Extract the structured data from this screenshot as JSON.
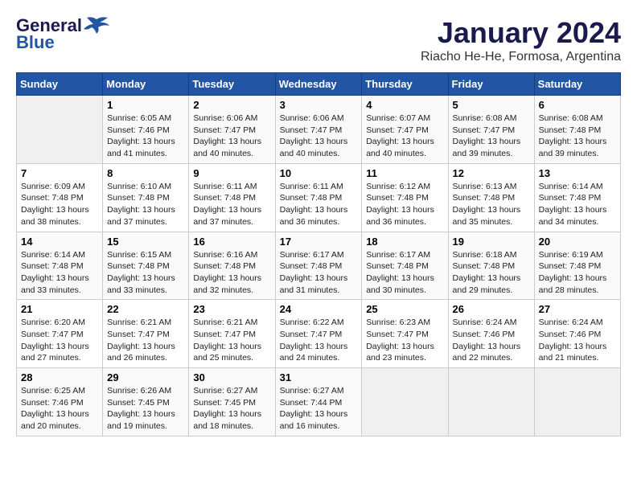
{
  "header": {
    "logo_line1": "General",
    "logo_line2": "Blue",
    "month": "January 2024",
    "location": "Riacho He-He, Formosa, Argentina"
  },
  "weekdays": [
    "Sunday",
    "Monday",
    "Tuesday",
    "Wednesday",
    "Thursday",
    "Friday",
    "Saturday"
  ],
  "weeks": [
    [
      null,
      {
        "day": 1,
        "sunrise": "6:05 AM",
        "sunset": "7:46 PM",
        "daylight": "13 hours and 41 minutes."
      },
      {
        "day": 2,
        "sunrise": "6:06 AM",
        "sunset": "7:47 PM",
        "daylight": "13 hours and 40 minutes."
      },
      {
        "day": 3,
        "sunrise": "6:06 AM",
        "sunset": "7:47 PM",
        "daylight": "13 hours and 40 minutes."
      },
      {
        "day": 4,
        "sunrise": "6:07 AM",
        "sunset": "7:47 PM",
        "daylight": "13 hours and 40 minutes."
      },
      {
        "day": 5,
        "sunrise": "6:08 AM",
        "sunset": "7:47 PM",
        "daylight": "13 hours and 39 minutes."
      },
      {
        "day": 6,
        "sunrise": "6:08 AM",
        "sunset": "7:48 PM",
        "daylight": "13 hours and 39 minutes."
      }
    ],
    [
      {
        "day": 7,
        "sunrise": "6:09 AM",
        "sunset": "7:48 PM",
        "daylight": "13 hours and 38 minutes."
      },
      {
        "day": 8,
        "sunrise": "6:10 AM",
        "sunset": "7:48 PM",
        "daylight": "13 hours and 37 minutes."
      },
      {
        "day": 9,
        "sunrise": "6:11 AM",
        "sunset": "7:48 PM",
        "daylight": "13 hours and 37 minutes."
      },
      {
        "day": 10,
        "sunrise": "6:11 AM",
        "sunset": "7:48 PM",
        "daylight": "13 hours and 36 minutes."
      },
      {
        "day": 11,
        "sunrise": "6:12 AM",
        "sunset": "7:48 PM",
        "daylight": "13 hours and 36 minutes."
      },
      {
        "day": 12,
        "sunrise": "6:13 AM",
        "sunset": "7:48 PM",
        "daylight": "13 hours and 35 minutes."
      },
      {
        "day": 13,
        "sunrise": "6:14 AM",
        "sunset": "7:48 PM",
        "daylight": "13 hours and 34 minutes."
      }
    ],
    [
      {
        "day": 14,
        "sunrise": "6:14 AM",
        "sunset": "7:48 PM",
        "daylight": "13 hours and 33 minutes."
      },
      {
        "day": 15,
        "sunrise": "6:15 AM",
        "sunset": "7:48 PM",
        "daylight": "13 hours and 33 minutes."
      },
      {
        "day": 16,
        "sunrise": "6:16 AM",
        "sunset": "7:48 PM",
        "daylight": "13 hours and 32 minutes."
      },
      {
        "day": 17,
        "sunrise": "6:17 AM",
        "sunset": "7:48 PM",
        "daylight": "13 hours and 31 minutes."
      },
      {
        "day": 18,
        "sunrise": "6:17 AM",
        "sunset": "7:48 PM",
        "daylight": "13 hours and 30 minutes."
      },
      {
        "day": 19,
        "sunrise": "6:18 AM",
        "sunset": "7:48 PM",
        "daylight": "13 hours and 29 minutes."
      },
      {
        "day": 20,
        "sunrise": "6:19 AM",
        "sunset": "7:48 PM",
        "daylight": "13 hours and 28 minutes."
      }
    ],
    [
      {
        "day": 21,
        "sunrise": "6:20 AM",
        "sunset": "7:47 PM",
        "daylight": "13 hours and 27 minutes."
      },
      {
        "day": 22,
        "sunrise": "6:21 AM",
        "sunset": "7:47 PM",
        "daylight": "13 hours and 26 minutes."
      },
      {
        "day": 23,
        "sunrise": "6:21 AM",
        "sunset": "7:47 PM",
        "daylight": "13 hours and 25 minutes."
      },
      {
        "day": 24,
        "sunrise": "6:22 AM",
        "sunset": "7:47 PM",
        "daylight": "13 hours and 24 minutes."
      },
      {
        "day": 25,
        "sunrise": "6:23 AM",
        "sunset": "7:47 PM",
        "daylight": "13 hours and 23 minutes."
      },
      {
        "day": 26,
        "sunrise": "6:24 AM",
        "sunset": "7:46 PM",
        "daylight": "13 hours and 22 minutes."
      },
      {
        "day": 27,
        "sunrise": "6:24 AM",
        "sunset": "7:46 PM",
        "daylight": "13 hours and 21 minutes."
      }
    ],
    [
      {
        "day": 28,
        "sunrise": "6:25 AM",
        "sunset": "7:46 PM",
        "daylight": "13 hours and 20 minutes."
      },
      {
        "day": 29,
        "sunrise": "6:26 AM",
        "sunset": "7:45 PM",
        "daylight": "13 hours and 19 minutes."
      },
      {
        "day": 30,
        "sunrise": "6:27 AM",
        "sunset": "7:45 PM",
        "daylight": "13 hours and 18 minutes."
      },
      {
        "day": 31,
        "sunrise": "6:27 AM",
        "sunset": "7:44 PM",
        "daylight": "13 hours and 16 minutes."
      },
      null,
      null,
      null
    ]
  ]
}
